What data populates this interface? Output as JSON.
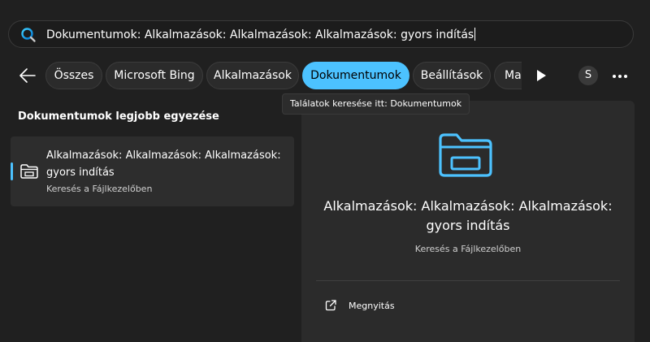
{
  "search": {
    "query": "Dokumentumok: Alkalmazások: Alkalmazások: Alkalmazások: gyors indítás"
  },
  "filters": {
    "chips": [
      {
        "label": "Összes",
        "active": false
      },
      {
        "label": "Microsoft Bing",
        "active": false
      },
      {
        "label": "Alkalmazások",
        "active": false
      },
      {
        "label": "Dokumentumok",
        "active": true
      },
      {
        "label": "Beállítások",
        "active": false
      },
      {
        "label": "Ma",
        "active": false
      }
    ],
    "avatar_initial": "S"
  },
  "tooltip": "Találatok keresése itt: Dokumentumok",
  "results": {
    "section_title": "Dokumentumok legjobb egyezése",
    "best_match": {
      "title": "Alkalmazások: Alkalmazások: Alkalmazások: gyors indítás",
      "subtitle": "Keresés a Fájlkezelőben",
      "icon": "folder-icon"
    }
  },
  "preview": {
    "icon": "folder-icon",
    "title": "Alkalmazások: Alkalmazások: Alkalmazások: gyors indítás",
    "subtitle": "Keresés a Fájlkezelőben",
    "actions": [
      {
        "label": "Megnyitás",
        "icon": "open-external-icon"
      }
    ]
  },
  "colors": {
    "accent": "#4cc2ff",
    "background": "#202020",
    "panel": "#2b2b2b",
    "selected_item": "#2d2d2d"
  }
}
